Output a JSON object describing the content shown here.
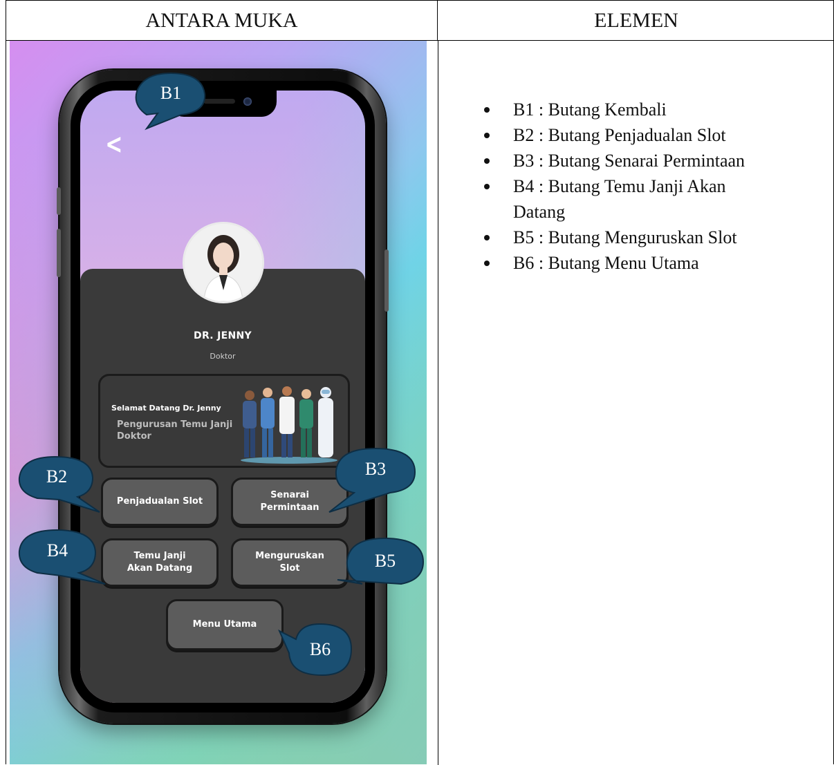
{
  "table": {
    "header_left": "ANTARA MUKA",
    "header_right": "ELEMEN"
  },
  "app": {
    "back_icon": "chevron-left-icon",
    "doctor_name": "DR. JENNY",
    "doctor_role": "Doktor",
    "welcome_line1": "Selamat Datang  Dr. Jenny",
    "welcome_line2": "Pengurusan Temu Janji Doktor",
    "buttons": {
      "penjadualan": "Penjadualan Slot",
      "senarai": "Senarai Permintaan",
      "temu_janji": "Temu Janji Akan Datang",
      "menguruskan": "Menguruskan Slot",
      "menu_utama": "Menu Utama"
    }
  },
  "callouts": [
    "B1",
    "B2",
    "B3",
    "B4",
    "B5",
    "B6"
  ],
  "callout_color": "#1a4f72",
  "elements": [
    "B1 : Butang Kembali",
    "B2 : Butang Penjadualan Slot",
    "B3 : Butang Senarai Permintaan",
    "B4 : Butang Temu Janji Akan Datang",
    "B5 : Butang Menguruskan Slot",
    "B6 : Butang Menu Utama"
  ]
}
